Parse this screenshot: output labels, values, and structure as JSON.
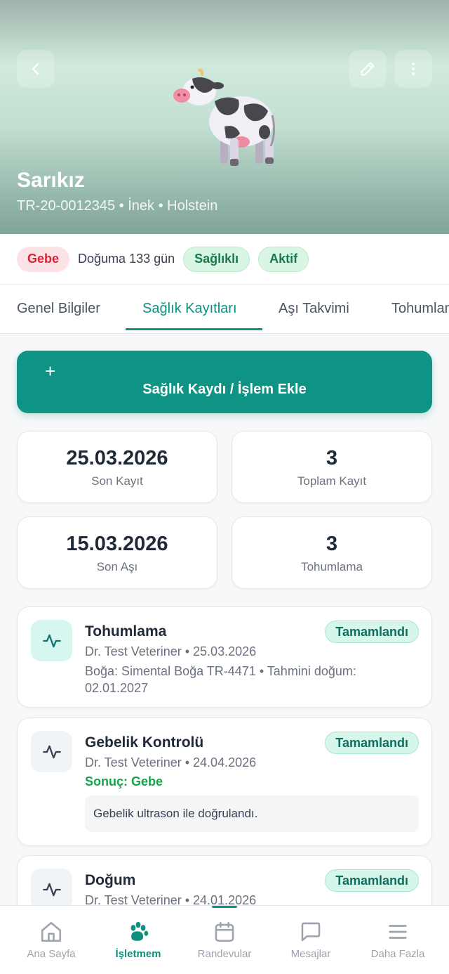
{
  "animal": {
    "name": "Sarıkız",
    "subtitle": "TR-20-0012345 • İnek • Holstein",
    "image": "cow-icon"
  },
  "header_actions": {
    "back": "back-icon",
    "edit": "pencil-icon",
    "more": "more-vertical-icon"
  },
  "status": {
    "pregnancy_badge": "Gebe",
    "due_text": "Doğuma 133 gün",
    "health_badge": "Sağlıklı",
    "state_badge": "Aktif"
  },
  "tabs": [
    {
      "label": "Genel Bilgiler"
    },
    {
      "label": "Sağlık Kayıtları",
      "active": true
    },
    {
      "label": "Aşı Takvimi"
    },
    {
      "label": "Tohumlama"
    }
  ],
  "add_button": {
    "plus": "+",
    "label": "Sağlık Kaydı / İşlem Ekle"
  },
  "stats": [
    {
      "value": "25.03.2026",
      "label": "Son Kayıt"
    },
    {
      "value": "3",
      "label": "Toplam Kayıt"
    },
    {
      "value": "15.03.2026",
      "label": "Son Aşı"
    },
    {
      "value": "3",
      "label": "Tohumlama"
    }
  ],
  "records": [
    {
      "title": "Tohumlama",
      "status": "Tamamlandı",
      "meta": "Dr. Test Veteriner • 25.03.2026",
      "description": "Boğa: Simental Boğa TR-4471 • Tahmini doğum: 02.01.2027",
      "icon": "activity-icon"
    },
    {
      "title": "Gebelik Kontrolü",
      "status": "Tamamlandı",
      "meta": "Dr. Test Veteriner • 24.04.2026",
      "result": "Sonuç: Gebe",
      "note": "Gebelik ultrason ile doğrulandı.",
      "icon": "activity-icon"
    },
    {
      "title": "Doğum",
      "status": "Tamamlandı",
      "meta": "Dr. Test Veteriner • 24.01.2026",
      "icon": "activity-icon"
    }
  ],
  "bottom_nav": [
    {
      "label": "Ana Sayfa",
      "icon": "home-icon"
    },
    {
      "label": "İşletmem",
      "icon": "paw-icon",
      "active": true
    },
    {
      "label": "Randevular",
      "icon": "calendar-icon"
    },
    {
      "label": "Mesajlar",
      "icon": "message-icon"
    },
    {
      "label": "Daha Fazla",
      "icon": "menu-icon"
    }
  ],
  "colors": {
    "primary": "#0f9384",
    "badge_red_bg": "#fde3e6",
    "badge_green_bg": "#d9f5e4",
    "success_text": "#16a34a"
  }
}
